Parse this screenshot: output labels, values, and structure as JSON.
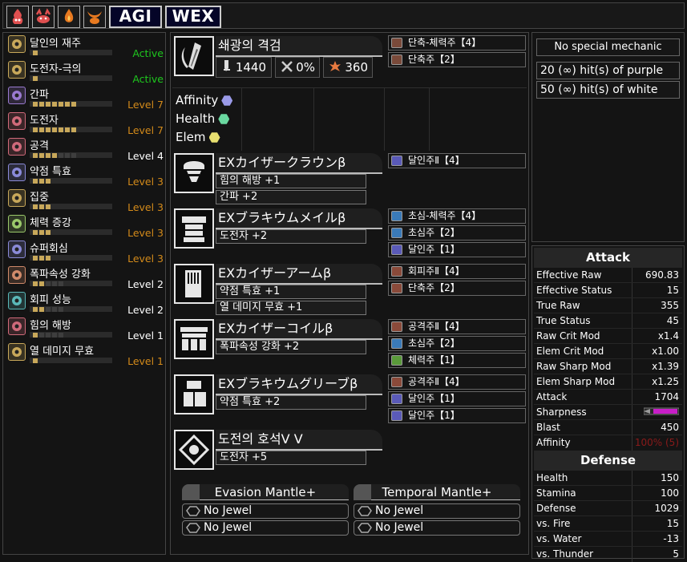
{
  "topbar": {
    "icons": [
      "flame-monster-icon",
      "crab-monster-icon",
      "fire-monster-icon",
      "horned-monster-icon"
    ],
    "tags": [
      "AGI",
      "WEX"
    ]
  },
  "skills": [
    {
      "name": "달인의 재주",
      "pips": 1,
      "max": 1,
      "level": "Active",
      "color": "#1ec81e",
      "icon": "master-touch-icon",
      "icolor": "#c8a85a"
    },
    {
      "name": "도전자-극의",
      "pips": 1,
      "max": 1,
      "level": "Active",
      "color": "#1ec81e",
      "icon": "agitator-secret-icon",
      "icolor": "#c8a85a"
    },
    {
      "name": "간파",
      "pips": 7,
      "max": 7,
      "level": "Level 7",
      "color": "#d38a1a",
      "icon": "weakness-exploit-icon",
      "icolor": "#9a7ad0"
    },
    {
      "name": "도전자",
      "pips": 7,
      "max": 7,
      "level": "Level 7",
      "color": "#d38a1a",
      "icon": "agitator-icon",
      "icolor": "#d06a7a"
    },
    {
      "name": "공격",
      "pips": 4,
      "max": 7,
      "level": "Level 4",
      "color": "#ffffff",
      "icon": "attack-icon",
      "icolor": "#d06a7a"
    },
    {
      "name": "약점 특효",
      "pips": 3,
      "max": 3,
      "level": "Level 3",
      "color": "#d38a1a",
      "icon": "weakness-exploit-icon",
      "icolor": "#8a8ad8"
    },
    {
      "name": "집중",
      "pips": 3,
      "max": 3,
      "level": "Level 3",
      "color": "#d38a1a",
      "icon": "focus-icon",
      "icolor": "#c8a85a"
    },
    {
      "name": "체력 증강",
      "pips": 3,
      "max": 3,
      "level": "Level 3",
      "color": "#d38a1a",
      "icon": "health-boost-icon",
      "icolor": "#9ac86a"
    },
    {
      "name": "슈퍼회심",
      "pips": 3,
      "max": 3,
      "level": "Level 3",
      "color": "#d38a1a",
      "icon": "critical-boost-icon",
      "icolor": "#8a8ad8"
    },
    {
      "name": "폭파속성 강화",
      "pips": 2,
      "max": 5,
      "level": "Level 2",
      "color": "#ffffff",
      "icon": "blast-attack-icon",
      "icolor": "#d08a6a"
    },
    {
      "name": "회피 성능",
      "pips": 2,
      "max": 5,
      "level": "Level 2",
      "color": "#ffffff",
      "icon": "evade-window-icon",
      "icolor": "#5ab8b8"
    },
    {
      "name": "힘의 해방",
      "pips": 1,
      "max": 5,
      "level": "Level 1",
      "color": "#ffffff",
      "icon": "latent-power-icon",
      "icolor": "#d06a7a"
    },
    {
      "name": "열 데미지 무효",
      "pips": 1,
      "max": 1,
      "level": "Level 1",
      "color": "#d38a1a",
      "icon": "heat-guard-icon",
      "icolor": "#c8a85a"
    }
  ],
  "weapon": {
    "name": "쇄광의 격검",
    "attack": "1440",
    "affinity": "0%",
    "element": "360",
    "decos": [
      "단축-체력주【4】",
      "단축주【2】"
    ],
    "row_labels": [
      "Affinity",
      "Health",
      "Elem"
    ],
    "row_colors": [
      "#9a9ae8",
      "#6ad8a0",
      "#e8e070"
    ]
  },
  "armor": [
    {
      "name": "EXカイザークラウンβ",
      "icon": "helm-icon",
      "skills": [
        "힘의 해방 +1",
        "간파 +2"
      ],
      "decos": [
        "달인주Ⅱ【4】"
      ]
    },
    {
      "name": "EXブラキウムメイルβ",
      "icon": "chest-icon",
      "skills": [
        "도전자 +2"
      ],
      "decos": [
        "초심-체력주【4】",
        "초심주【2】",
        "달인주【1】"
      ]
    },
    {
      "name": "EXカイザーアームβ",
      "icon": "arms-icon",
      "skills": [
        "약점 특효 +1",
        "열 데미지 무효 +1"
      ],
      "decos": [
        "회피주Ⅱ【4】",
        "단축주【2】"
      ]
    },
    {
      "name": "EXカイザーコイルβ",
      "icon": "waist-icon",
      "skills": [
        "폭파속성 강화 +2"
      ],
      "decos": [
        "공격주Ⅱ【4】",
        "초심주【2】",
        "체력주【1】"
      ]
    },
    {
      "name": "EXブラキウムグリーブβ",
      "icon": "legs-icon",
      "skills": [
        "약점 특효 +2"
      ],
      "decos": [
        "공격주Ⅱ【4】",
        "달인주【1】",
        "달인주【1】"
      ]
    },
    {
      "name": "도전의 호석Ⅴ Ⅴ",
      "icon": "charm-icon",
      "skills": [
        "도전자 +5"
      ],
      "decos": []
    }
  ],
  "mantles": [
    {
      "name": "Evasion Mantle+",
      "jewels": [
        "No Jewel",
        "No Jewel"
      ]
    },
    {
      "name": "Temporal Mantle+",
      "jewels": [
        "No Jewel",
        "No Jewel"
      ]
    }
  ],
  "info": {
    "mechanic": "No special mechanic",
    "hits": [
      "20 (∞) hit(s) of purple",
      "50 (∞) hit(s) of white"
    ]
  },
  "attack": {
    "title": "Attack",
    "rows": [
      {
        "label": "Effective Raw",
        "value": "690.83"
      },
      {
        "label": "Effective Status",
        "value": "15"
      },
      {
        "label": "True Raw",
        "value": "355"
      },
      {
        "label": "True Status",
        "value": "45"
      },
      {
        "label": "Raw Crit Mod",
        "value": "x1.4"
      },
      {
        "label": "Elem Crit Mod",
        "value": "x1.00"
      },
      {
        "label": "Raw Sharp Mod",
        "value": "x1.39"
      },
      {
        "label": "Elem Sharp Mod",
        "value": "x1.25"
      },
      {
        "label": "Attack",
        "value": "1704"
      },
      {
        "label": "Sharpness",
        "value": ""
      },
      {
        "label": "Blast",
        "value": "450"
      },
      {
        "label": "Affinity",
        "value": "100% (5)",
        "color": "#8a1a1a"
      }
    ],
    "sharpness_color": "#c81ec8"
  },
  "defense": {
    "title": "Defense",
    "rows": [
      {
        "label": "Health",
        "value": "150"
      },
      {
        "label": "Stamina",
        "value": "100"
      },
      {
        "label": "Defense",
        "value": "1029"
      },
      {
        "label": "vs. Fire",
        "value": "15"
      },
      {
        "label": "vs. Water",
        "value": "-13"
      },
      {
        "label": "vs. Thunder",
        "value": "5"
      }
    ]
  }
}
